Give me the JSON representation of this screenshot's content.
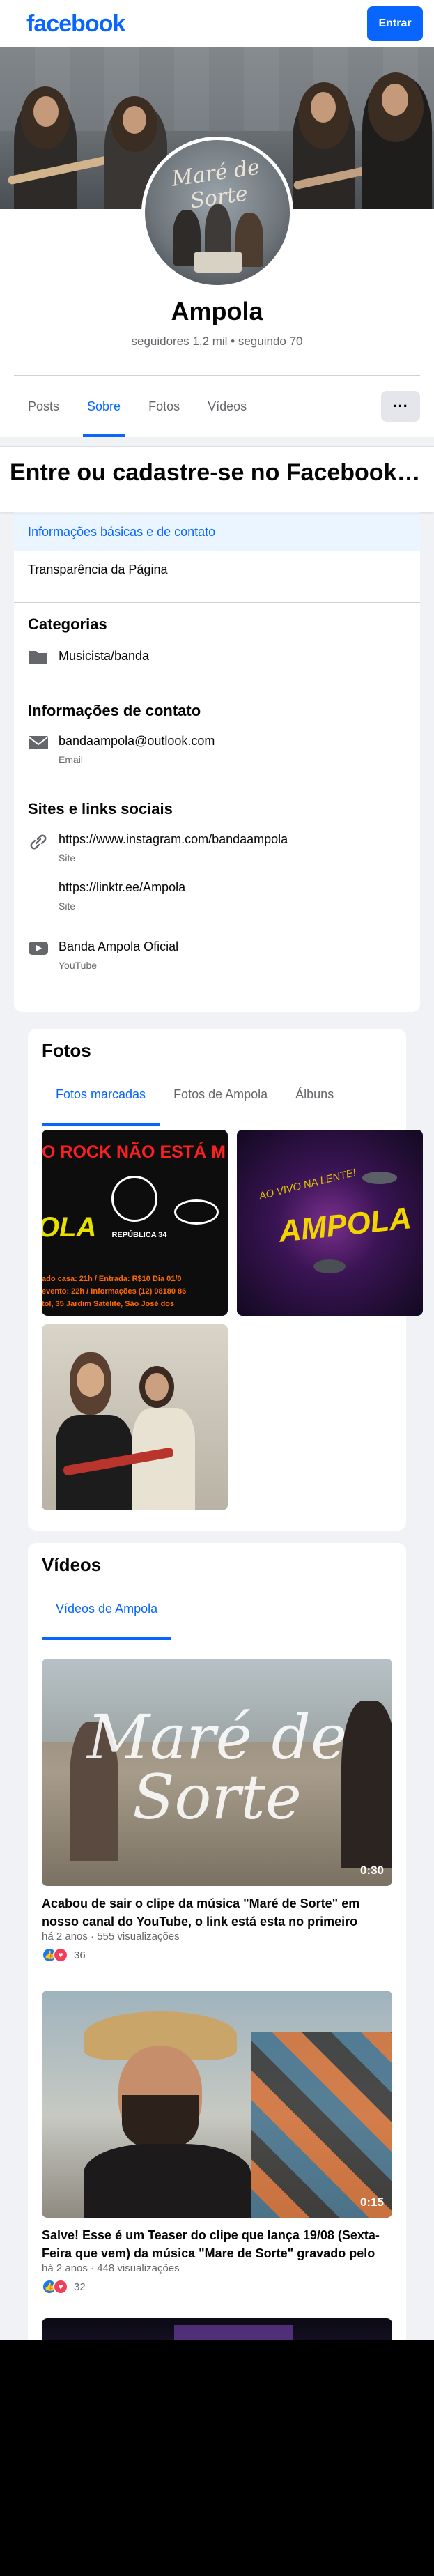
{
  "header": {
    "logo": "facebook",
    "login_label": "Entrar"
  },
  "profile": {
    "name": "Ampola",
    "stats": "seguidores 1,2 mil • seguindo 70",
    "avatar_script": "Maré de Sorte"
  },
  "tabs": [
    {
      "label": "Posts",
      "active": false
    },
    {
      "label": "Sobre",
      "active": true
    },
    {
      "label": "Fotos",
      "active": false
    },
    {
      "label": "Vídeos",
      "active": false
    }
  ],
  "more_label": "···",
  "login_banner": "Entre ou cadastre-se no Facebook para continuar",
  "about": {
    "nav": [
      {
        "label": "Informações básicas e de contato",
        "selected": true
      },
      {
        "label": "Transparência da Página",
        "selected": false
      }
    ],
    "categories_title": "Categorias",
    "category": "Musicista/banda",
    "contact_title": "Informações de contato",
    "email": "bandaampola@outlook.com",
    "email_label": "Email",
    "social_title": "Sites e links sociais",
    "sites": [
      {
        "url": "https://www.instagram.com/bandaampola",
        "label": "Site"
      },
      {
        "url": "https://linktr.ee/Ampola",
        "label": "Site"
      }
    ],
    "youtube": {
      "name": "Banda Ampola Oficial",
      "label": "YouTube"
    }
  },
  "photos": {
    "title": "Fotos",
    "tabs": [
      "Fotos marcadas",
      "Fotos de Ampola",
      "Álbuns"
    ],
    "photo1": {
      "headline": "O ROCK NÃO ESTÁ M",
      "logo": "REPÚBLICA 34",
      "left": "OLA",
      "line1": "ado casa: 21h / Entrada: R$10   Dia 01/0",
      "line2": "evento: 22h / Informações (12) 98180 86",
      "line3": "tol, 35 Jardim Satélite, São José dos"
    },
    "photo2": {
      "top": "AO VIVO NA LENTE!",
      "name": "AMPOLA"
    }
  },
  "videos": {
    "title": "Vídeos",
    "tab": "Vídeos de Ampola",
    "items": [
      {
        "overlay": "Maré de Sorte",
        "duration": "0:30",
        "title": "Acabou de sair o clipe da música \"Maré de Sorte\" em nosso canal do YouTube, o link está esta no primeiro comentário 📌...",
        "meta": "há 2 anos · 555 visualizações",
        "reactions": "36"
      },
      {
        "duration": "0:15",
        "title": "Salve! Esse é um Teaser do clipe que lança 19/08 (Sexta-Feira que vem) da música \"Mare de Sorte\" gravado pelo Studio...",
        "meta": "há 2 anos · 448 visualizações",
        "reactions": "32"
      }
    ]
  },
  "colors": {
    "brand": "#0866ff",
    "page_bg": "#f0f2f5",
    "muted": "#65676b"
  }
}
